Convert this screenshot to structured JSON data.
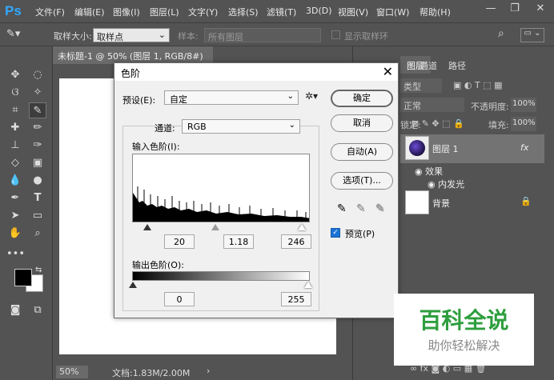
{
  "app": {
    "logo": "Ps"
  },
  "menu": [
    "文件(F)",
    "编辑(E)",
    "图像(I)",
    "图层(L)",
    "文字(Y)",
    "选择(S)",
    "滤镜(T)",
    "3D(D)",
    "视图(V)",
    "窗口(W)",
    "帮助(H)"
  ],
  "window": {
    "minimize": "—",
    "restore": "❐",
    "close": "✕"
  },
  "options": {
    "sample_size_label": "取样大小:",
    "sample_size_value": "取样点",
    "sample_label": "样本:",
    "sample_value": "所有图层",
    "show_ring_label": "显示取样环"
  },
  "document": {
    "tab_title": "未标题-1 @ 50% (图层 1, RGB/8#) *",
    "tab_close": "✕",
    "zoom": "50%",
    "doc_info": "文档:1.83M/2.00M"
  },
  "panels": {
    "tabs": [
      "图层",
      "通道",
      "路径"
    ],
    "kind_label": "类型",
    "blend_mode": "正常",
    "opacity_label": "不透明度:",
    "opacity_value": "100%",
    "lock_label": "锁定:",
    "fill_label": "填充:",
    "fill_value": "100%",
    "layers": [
      {
        "name": "图层 1",
        "fx": "fx"
      },
      {
        "name": "背景"
      }
    ],
    "effects_label": "效果",
    "inner_glow_label": "内发光"
  },
  "dialog": {
    "title": "色阶",
    "preset_label": "预设(E):",
    "preset_value": "自定",
    "channel_label": "通道:",
    "channel_value": "RGB",
    "input_label": "输入色阶(I):",
    "input_black": "20",
    "input_gamma": "1.18",
    "input_white": "246",
    "output_label": "输出色阶(O):",
    "output_black": "0",
    "output_white": "255",
    "btn_ok": "确定",
    "btn_cancel": "取消",
    "btn_auto": "自动(A)",
    "btn_options": "选项(T)...",
    "preview_label": "预览(P)",
    "preview_checked": true,
    "close": "✕"
  },
  "watermark": {
    "title": "百科全说",
    "subtitle": "助你轻松解决",
    "title_color": "#2e9e3e"
  }
}
